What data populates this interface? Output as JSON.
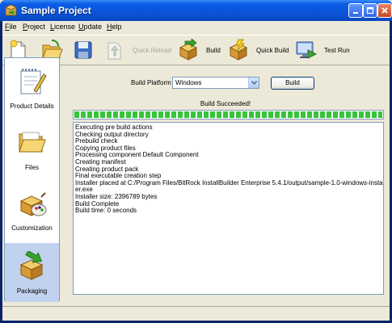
{
  "window": {
    "title": "Sample Project"
  },
  "menu": [
    "File",
    "Project",
    "License",
    "Update",
    "Help"
  ],
  "toolbar": {
    "quick_reload": "Quick Reload",
    "build": "Build",
    "quick_build": "Quick Build",
    "test_run": "Test Run"
  },
  "sidebar": {
    "items": [
      {
        "label": "Product Details",
        "icon": "notepad-icon"
      },
      {
        "label": "Files",
        "icon": "folder-icon"
      },
      {
        "label": "Customization",
        "icon": "palette-icon"
      },
      {
        "label": "Packaging",
        "icon": "package-icon",
        "selected": true
      }
    ]
  },
  "build": {
    "platform_label": "Build Platform",
    "platform_value": "Windows",
    "button_label": "Build",
    "status": "Build Succeeded!",
    "progress": 1.0
  },
  "log": [
    "Executing pre build actions",
    "Checking output directory",
    "Prebuild check",
    "Copying product files",
    "Processing component Default Component",
    "Creating manifest",
    "Creating product pack",
    "Final executable creation step",
    "Installer placed at C:/Program Files/BitRock InstallBuilder Enterprise 5.4.1/output/sample-1.0-windows-install",
    "er.exe",
    "Installer size: 2396789 bytes",
    "Build Complete",
    "Build time: 0 seconds"
  ],
  "colors": {
    "titlebar": "#0a54d8",
    "progress": "#37c43a",
    "selection": "#c1d2ee"
  }
}
